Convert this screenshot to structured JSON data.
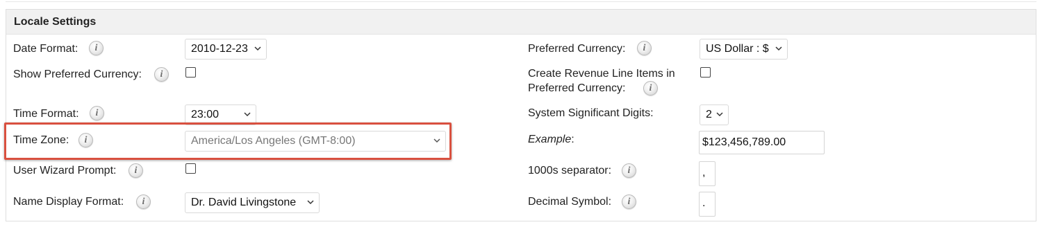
{
  "panel": {
    "title": "Locale Settings"
  },
  "left": {
    "date_format": {
      "label": "Date Format:",
      "value": "2010-12-23"
    },
    "show_preferred_currency": {
      "label": "Show Preferred Currency:",
      "checked": false
    },
    "time_format": {
      "label": "Time Format:",
      "value": "23:00"
    },
    "time_zone": {
      "label": "Time Zone:",
      "value": "America/Los Angeles (GMT-8:00)"
    },
    "user_wizard_prompt": {
      "label": "User Wizard Prompt:",
      "checked": false
    },
    "name_display_format": {
      "label": "Name Display Format:",
      "value": "Dr. David Livingstone"
    }
  },
  "right": {
    "preferred_currency": {
      "label": "Preferred Currency:",
      "value": "US Dollar : $"
    },
    "create_revenue_line_items": {
      "label_line1": "Create Revenue Line Items in",
      "label_line2": "Preferred Currency:",
      "checked": false
    },
    "system_significant_digits": {
      "label": "System Significant Digits:",
      "value": "2"
    },
    "example": {
      "label_italic": "Example",
      "label_suffix": ":",
      "value": "$123,456,789.00"
    },
    "thousands_separator": {
      "label": "1000s separator:",
      "value": ","
    },
    "decimal_symbol": {
      "label": "Decimal Symbol:",
      "value": "."
    }
  },
  "icons": {
    "info": "i"
  },
  "colors": {
    "highlight": "#d9503f",
    "header_bg": "#f1f1f1"
  }
}
